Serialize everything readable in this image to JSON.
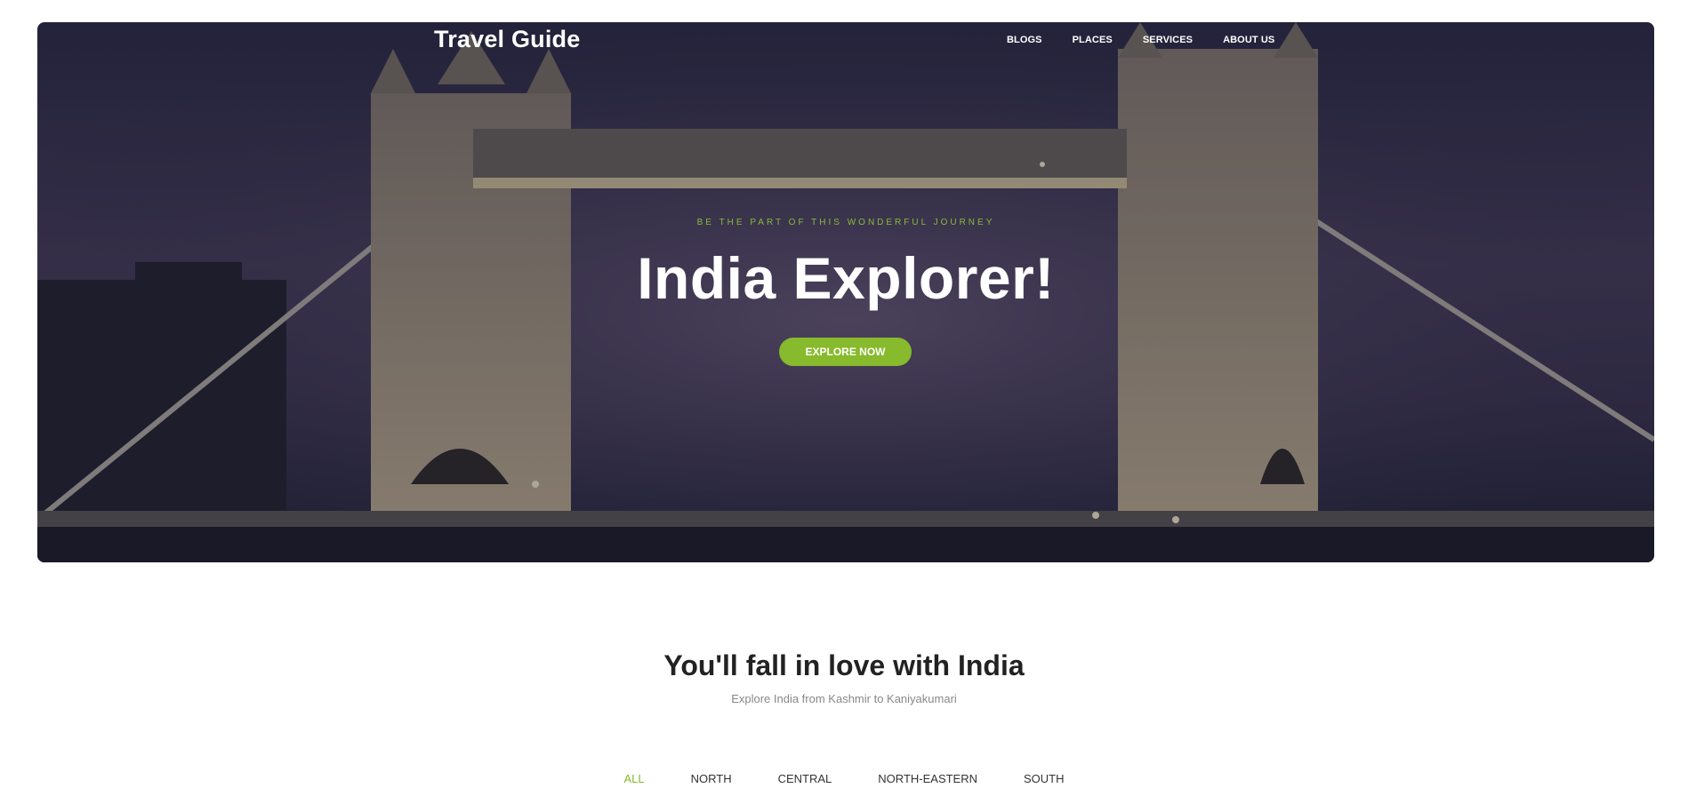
{
  "brand": {
    "name": "Travel Guide"
  },
  "nav": {
    "items": [
      {
        "label": "BLOGS"
      },
      {
        "label": "PLACES"
      },
      {
        "label": "SERVICES"
      },
      {
        "label": "ABOUT US"
      }
    ]
  },
  "hero": {
    "eyebrow": "BE THE PART OF THIS WONDERFUL JOURNEY",
    "title": "India Explorer!",
    "cta_label": "EXPLORE NOW"
  },
  "section": {
    "title": "You'll fall in love with India",
    "subtitle": "Explore India from Kashmir to Kaniyakumari"
  },
  "filters": {
    "items": [
      {
        "label": "ALL",
        "active": true
      },
      {
        "label": "NORTH",
        "active": false
      },
      {
        "label": "CENTRAL",
        "active": false
      },
      {
        "label": "NORTH-EASTERN",
        "active": false
      },
      {
        "label": "SOUTH",
        "active": false
      }
    ]
  },
  "colors": {
    "accent": "#87ba2c",
    "eyebrow": "#8aba3a",
    "heading": "#222222",
    "muted": "#888888"
  },
  "icons": {
    "hero_image": "tower-bridge-night-photo"
  }
}
